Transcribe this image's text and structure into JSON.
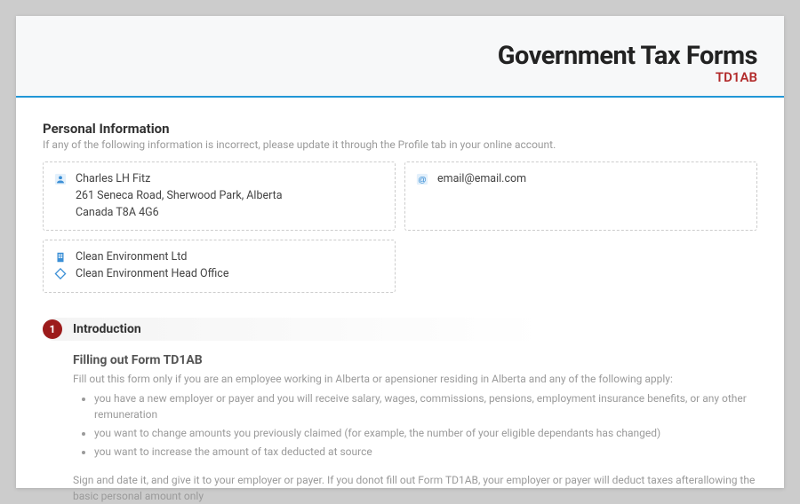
{
  "header": {
    "title": "Government Tax Forms",
    "subtitle": "TD1AB"
  },
  "personal": {
    "heading": "Personal Information",
    "help": "If any of the following information is incorrect, please update it through the Profile tab in your online account.",
    "name": "Charles LH Fitz",
    "address_line1": "261 Seneca Road, Sherwood Park, Alberta",
    "address_line2": "Canada T8A 4G6",
    "email": "email@email.com",
    "company": "Clean Environment Ltd",
    "office": "Clean Environment Head Office"
  },
  "intro": {
    "step": "1",
    "title": "Introduction",
    "subtitle": "Filling out Form TD1AB",
    "lead": "Fill out this form only if you are an employee working in Alberta or apensioner residing in Alberta and any of the following apply:",
    "bullets": [
      "you have a new employer or payer and you will receive salary, wages, commissions, pensions, employment insurance benefits, or any other remuneration",
      "you want to change amounts you previously claimed (for example, the number of your eligible dependants has changed)",
      "you want to increase the amount of tax deducted at source"
    ],
    "footer": "Sign and date it, and give it to your employer or payer. If you donot fill out Form TD1AB, your employer or payer will deduct taxes afterallowing the basic personal amount only"
  }
}
